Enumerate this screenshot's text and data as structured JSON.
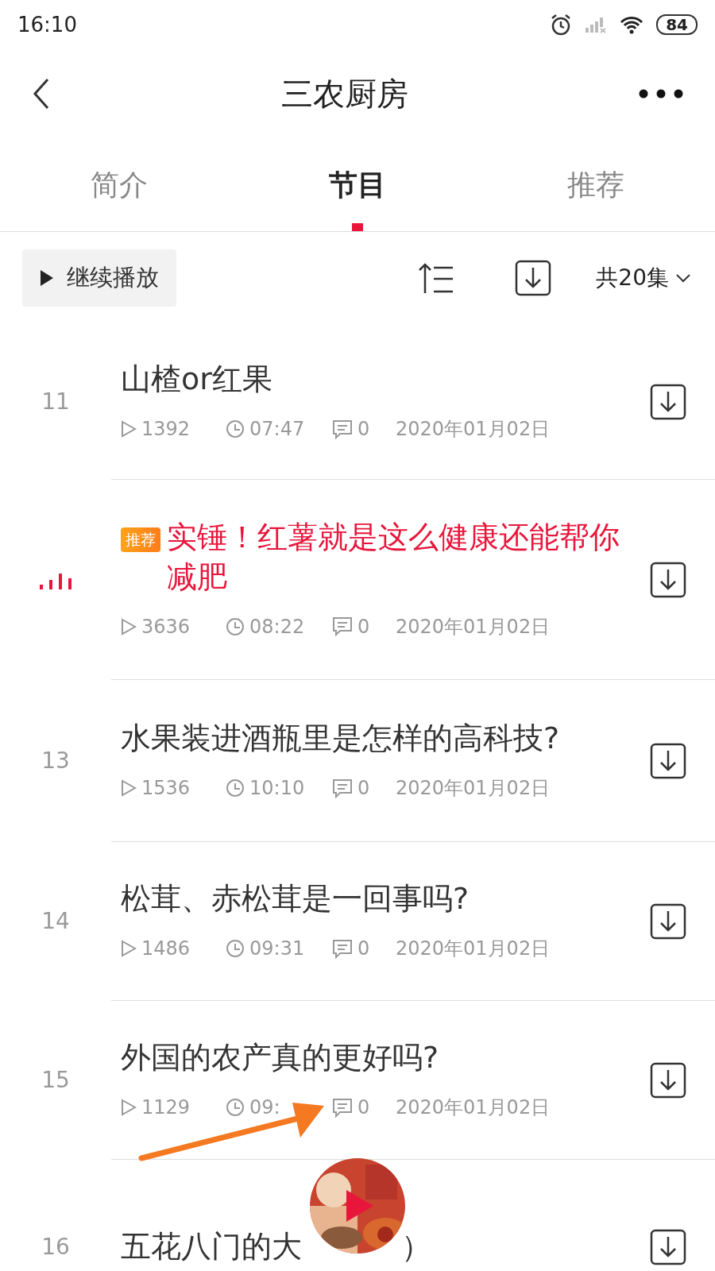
{
  "status_bar": {
    "time": "16:10",
    "battery": "84"
  },
  "header": {
    "title": "三农厨房"
  },
  "tabs": [
    {
      "label": "简介",
      "selected": false
    },
    {
      "label": "节目",
      "selected": true
    },
    {
      "label": "推荐",
      "selected": false
    }
  ],
  "toolbar": {
    "continue_button": "继续播放",
    "episode_count": "共20集"
  },
  "episodes": [
    {
      "number": "11",
      "playing": false,
      "title": "山楂or红果",
      "plays": "1392",
      "duration": "07:47",
      "comments": "0",
      "date": "2020年01月02日"
    },
    {
      "playing": true,
      "badge": "推荐",
      "title": "实锤！红薯就是这么健康还能帮你减肥",
      "plays": "3636",
      "duration": "08:22",
      "comments": "0",
      "date": "2020年01月02日"
    },
    {
      "number": "13",
      "playing": false,
      "title": "水果装进酒瓶里是怎样的高科技?",
      "plays": "1536",
      "duration": "10:10",
      "comments": "0",
      "date": "2020年01月02日"
    },
    {
      "number": "14",
      "playing": false,
      "title": "松茸、赤松茸是一回事吗?",
      "plays": "1486",
      "duration": "09:31",
      "comments": "0",
      "date": "2020年01月02日"
    },
    {
      "number": "15",
      "playing": false,
      "title": "外国的农产真的更好吗?",
      "plays": "1129",
      "duration": "09:",
      "comments": "0",
      "date": "2020年01月02日"
    },
    {
      "number": "16",
      "playing": false,
      "title": "五花八门的大",
      "title_end": "）"
    }
  ]
}
